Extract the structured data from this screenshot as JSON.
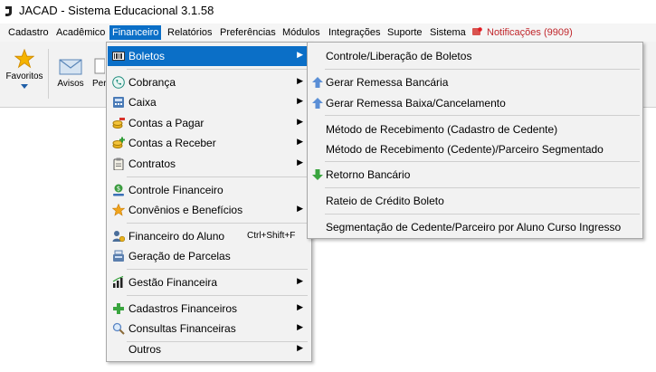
{
  "window": {
    "title": "JACAD - Sistema Educacional 3.1.58"
  },
  "menubar": {
    "items": [
      "Cadastro",
      "Acadêmico",
      "Financeiro",
      "Relatórios",
      "Preferências",
      "Módulos",
      "Integrações",
      "Suporte",
      "Sistema"
    ],
    "active": "Financeiro",
    "notifications_label": "Notificações (9909)"
  },
  "toolbar": {
    "favoritos_label": "Favoritos",
    "avisos_label": "Avisos",
    "partial_label": "Per"
  },
  "financeiro_menu": {
    "items": [
      {
        "label": "Boletos",
        "icon": "boleto-icon",
        "submenu": true
      },
      {
        "label": "Cobrança",
        "icon": "phone-icon",
        "submenu": true
      },
      {
        "label": "Caixa",
        "icon": "register-icon",
        "submenu": true
      },
      {
        "label": "Contas a Pagar",
        "icon": "coins-minus-icon",
        "submenu": true
      },
      {
        "label": "Contas a Receber",
        "icon": "coins-plus-icon",
        "submenu": true
      },
      {
        "label": "Contratos",
        "icon": "clipboard-icon",
        "submenu": true
      },
      {
        "label": "Controle Financeiro",
        "icon": "money-hand-icon",
        "submenu": false
      },
      {
        "label": "Convênios e Benefícios",
        "icon": "star-icon",
        "submenu": true
      },
      {
        "label": "Financeiro do Aluno",
        "icon": "student-money-icon",
        "submenu": false,
        "shortcut": "Ctrl+Shift+F"
      },
      {
        "label": "Geração de Parcelas",
        "icon": "cash-register-icon",
        "submenu": false
      },
      {
        "label": "Gestão Financeira",
        "icon": "chart-icon",
        "submenu": true
      },
      {
        "label": "Cadastros Financeiros",
        "icon": "plus-icon",
        "submenu": true
      },
      {
        "label": "Consultas Financeiras",
        "icon": "magnifier-icon",
        "submenu": true
      },
      {
        "label": "Outros",
        "icon": "",
        "submenu": true
      }
    ]
  },
  "boletos_submenu": {
    "items": [
      {
        "label": "Controle/Liberação de Boletos",
        "icon": ""
      },
      {
        "label": "Gerar Remessa Bancária",
        "icon": "upload-arrow-icon"
      },
      {
        "label": "Gerar Remessa Baixa/Cancelamento",
        "icon": "upload-arrow-icon"
      },
      {
        "label": "Método de Recebimento (Cadastro de Cedente)",
        "icon": ""
      },
      {
        "label": "Método de Recebimento (Cedente)/Parceiro Segmentado",
        "icon": ""
      },
      {
        "label": "Retorno Bancário",
        "icon": "download-arrow-icon"
      },
      {
        "label": "Rateio de Crédito Boleto",
        "icon": ""
      },
      {
        "label": "Segmentação de Cedente/Parceiro por Aluno Curso Ingresso",
        "icon": ""
      }
    ]
  },
  "colors": {
    "highlight": "#0b6fc7",
    "notification": "#c0262b",
    "menu_bg": "#f2f2f2"
  }
}
